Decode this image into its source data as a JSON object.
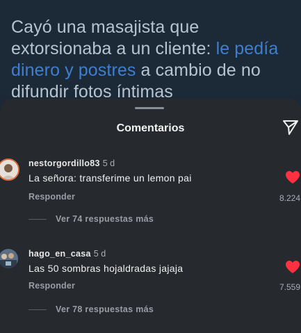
{
  "post": {
    "headline_part1": "Cayó una masajista que extorsionaba a un cliente: ",
    "headline_link": "le pedía dinero y postres",
    "headline_part2": " a cambio de no difundir fotos íntimas"
  },
  "sheet": {
    "title": "Comentarios"
  },
  "comments": [
    {
      "username": "nestorgordillo83",
      "time": "5 d",
      "text": "La señora: transferime un lemon pai",
      "reply_label": "Responder",
      "likes": "8.224",
      "more_replies": "Ver 74 respuestas más"
    },
    {
      "username": "hago_en_casa",
      "time": "5 d",
      "text": "Las 50 sombras hojaldradas jajaja",
      "reply_label": "Responder",
      "likes": "7.559",
      "more_replies": "Ver 78 respuestas más"
    }
  ],
  "colors": {
    "heart": "#ff3040",
    "link": "#3e7fd0"
  },
  "icons": {
    "share": "paper-plane-icon",
    "like": "heart-icon"
  }
}
